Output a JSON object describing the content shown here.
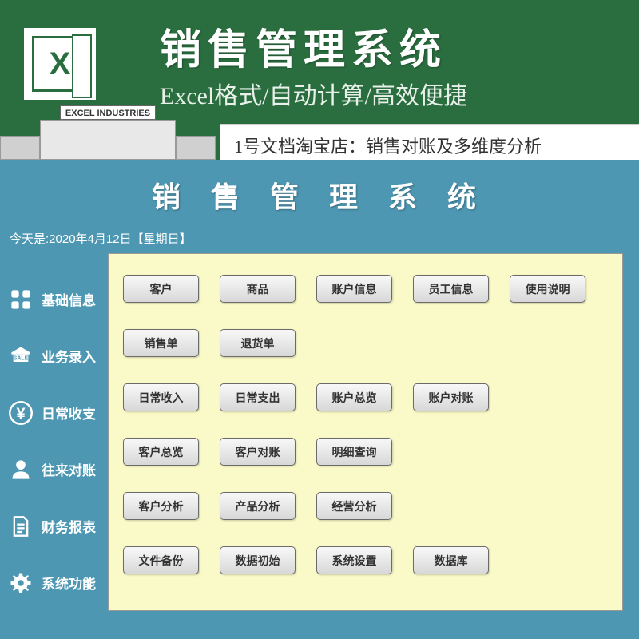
{
  "header": {
    "title": "销售管理系统",
    "subtitle": "Excel格式/自动计算/高效便捷",
    "building_sign": "EXCEL INDUSTRIES",
    "shop_banner": "1号文档淘宝店：销售对账及多维度分析"
  },
  "app": {
    "title": "销 售 管 理 系 统",
    "date_label": "今天是:2020年4月12日【星期日】"
  },
  "sidebar": {
    "items": [
      {
        "label": "基础信息",
        "icon": "grid"
      },
      {
        "label": "业务录入",
        "icon": "sale"
      },
      {
        "label": "日常收支",
        "icon": "yen"
      },
      {
        "label": "往来对账",
        "icon": "person"
      },
      {
        "label": "财务报表",
        "icon": "document"
      },
      {
        "label": "系统功能",
        "icon": "gear"
      }
    ]
  },
  "rows": [
    {
      "buttons": [
        "客户",
        "商品",
        "账户信息",
        "员工信息",
        "使用说明"
      ]
    },
    {
      "buttons": [
        "销售单",
        "退货单"
      ]
    },
    {
      "buttons": [
        "日常收入",
        "日常支出",
        "账户总览",
        "账户对账"
      ]
    },
    {
      "buttons": [
        "客户总览",
        "客户对账",
        "明细查询"
      ]
    },
    {
      "buttons": [
        "客户分析",
        "产品分析",
        "经营分析"
      ]
    },
    {
      "buttons": [
        "文件备份",
        "数据初始",
        "系统设置",
        "数据库"
      ]
    }
  ]
}
